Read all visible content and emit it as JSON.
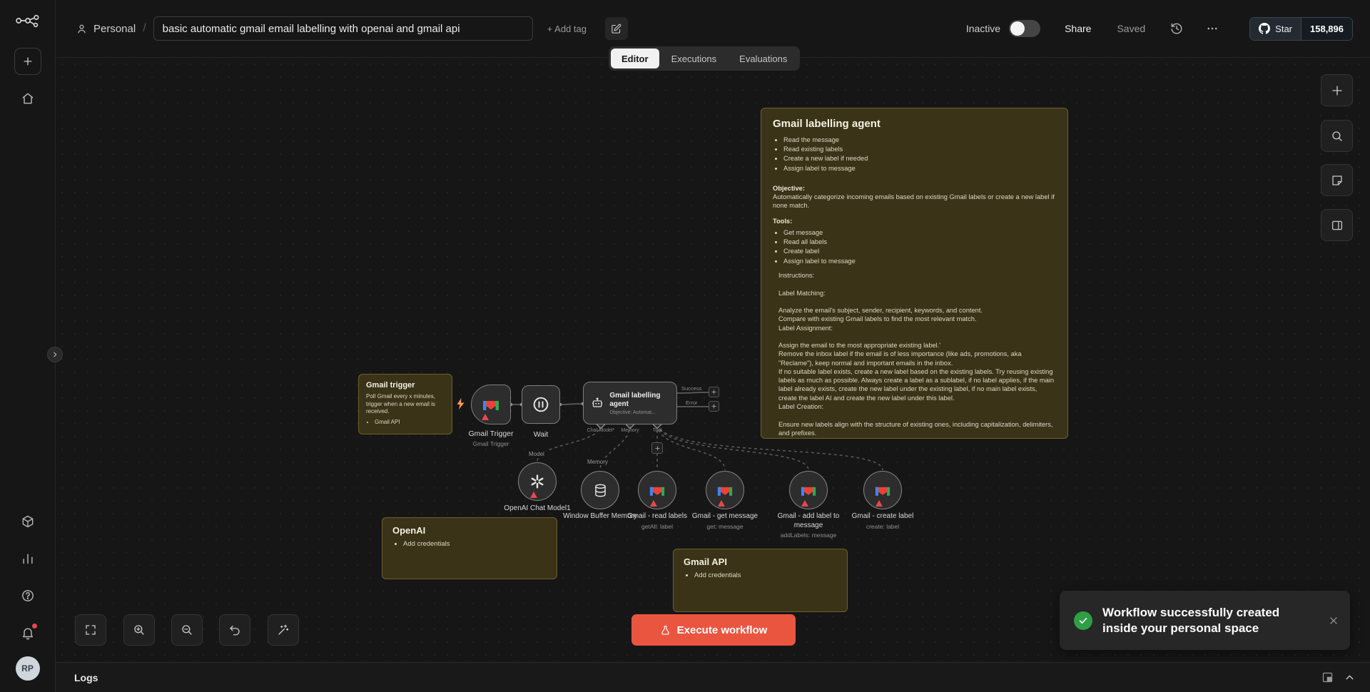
{
  "colors": {
    "accent": "#ea5540",
    "success": "#2f9e44",
    "warning": "#e5484d",
    "sticky_bg": "#3a3318",
    "gmail": {
      "blue": "#4285F4",
      "red": "#EA4335",
      "green": "#34A853",
      "yellow": "#FBBC04"
    }
  },
  "sidebar": {
    "avatar_initials": "RP"
  },
  "header": {
    "project": "Personal",
    "separator": "/",
    "title": "basic automatic gmail email labelling with openai and gmail api",
    "add_tag": "+ Add tag",
    "status": "Inactive",
    "share": "Share",
    "saved": "Saved",
    "github": {
      "star": "Star",
      "count": "158,896"
    }
  },
  "tabs": {
    "editor": "Editor",
    "executions": "Executions",
    "evaluations": "Evaluations"
  },
  "canvas": {
    "sticky_agent": {
      "title": "Gmail labelling agent",
      "bullets": [
        "Read the message",
        "Read existing labels",
        "Create a new label if needed",
        "Assign label to message"
      ],
      "objective_heading": "Objective:",
      "objective": "Automatically categorize incoming emails based on existing Gmail labels or create a new label if none match.",
      "tools_heading": "Tools:",
      "tools": [
        "Get message",
        "Read all labels",
        "Create label",
        "Assign label to message"
      ],
      "instructions": "Instructions:\n\nLabel Matching:\n\nAnalyze the email's subject, sender, recipient, keywords, and content.\nCompare with existing Gmail labels to find the most relevant match.\nLabel Assignment:\n\nAssign the email to the most appropriate existing label.'\nRemove the inbox label if the email is of less importance (like ads, promotions, aka \"Reclame\"), keep normal and important emails in the inbox.\nIf no suitable label exists, create a new label based on the existing labels. Try reusing existing labels as much as possible. Always create a label as a sublabel, if no label applies, if the main label already exists, create the new label under the existing label, if no main label exists, create the label AI and create the new label under this label.\nLabel Creation:\n\nEnsure new labels align with the structure of existing ones, including capitalization, delimiters, and prefixes.\nExamples:\n\nIf the email subject is \"Project Alpha Update,\" assign to [Project Alpha] if it exists.\nFor \"New Vendor Inquiry,\" create \"Vendor Inquiry\" if no relevant label exists.\nOutcome:\nEmails are consistently categorized under the appropriate or newly created labels, maintaining Gmail's organizational structure."
    },
    "sticky_trigger": {
      "title": "Gmail trigger",
      "body": "Poll Gmail every x minutes, trigger when a new email is received.",
      "bullets": [
        "Gmail API"
      ]
    },
    "sticky_openai": {
      "title": "OpenAI",
      "bullets": [
        "Add credentials"
      ]
    },
    "sticky_gmail_api": {
      "title": "Gmail API",
      "bullets": [
        "Add credentials"
      ]
    },
    "nodes": {
      "gmail_trigger": {
        "label": "Gmail Trigger",
        "subtitle": "Gmail Trigger"
      },
      "wait": {
        "label": "Wait"
      },
      "agent": {
        "label": "Gmail labelling agent",
        "subtitle": "Objective: Automat...",
        "ports": [
          "Chat Model*",
          "Memory",
          "Tool"
        ],
        "outputs": [
          "Success",
          "Error"
        ]
      },
      "openai_model": {
        "label": "OpenAI Chat Model1"
      },
      "memory": {
        "label": "Window Buffer Memory"
      },
      "read_labels": {
        "label": "Gmail - read labels",
        "subtitle": "getAll: label"
      },
      "get_message": {
        "label": "Gmail - get message",
        "subtitle": "get: message"
      },
      "add_label": {
        "label": "Gmail - add label to message",
        "subtitle": "addLabels: message"
      },
      "create_label": {
        "label": "Gmail - create label",
        "subtitle": "create: label"
      }
    },
    "connection_labels": {
      "model": "Model",
      "memory": "Memory"
    },
    "execute_button": "Execute workflow"
  },
  "toast": {
    "message": "Workflow successfully created inside your personal space"
  },
  "logs": {
    "label": "Logs"
  }
}
